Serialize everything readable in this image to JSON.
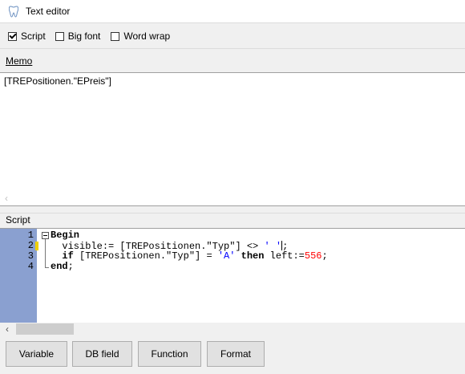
{
  "window": {
    "title": "Text editor",
    "icon": "tooth-icon"
  },
  "options": {
    "script": {
      "label": "Script",
      "checked": true
    },
    "big_font": {
      "label": "Big font",
      "checked": false
    },
    "word_wrap": {
      "label": "Word wrap",
      "checked": false
    }
  },
  "memo": {
    "label": "Memo",
    "text": "[TREPositionen.\"EPreis\"]"
  },
  "script": {
    "label": "Script",
    "line_numbers": [
      "1",
      "2",
      "3",
      "4"
    ],
    "lines": [
      {
        "indent": "",
        "parts": [
          {
            "t": "Begin",
            "c": "kw"
          }
        ]
      },
      {
        "indent": "  ",
        "parts": [
          {
            "t": "visible:= [TREPositionen.\"Typ\"] <> ",
            "c": ""
          },
          {
            "t": "' '",
            "c": "str"
          },
          {
            "t": "|",
            "c": "caret"
          },
          {
            "t": ";",
            "c": ""
          }
        ]
      },
      {
        "indent": "  ",
        "parts": [
          {
            "t": "if",
            "c": "kw"
          },
          {
            "t": " [TREPositionen.\"Typ\"] = ",
            "c": ""
          },
          {
            "t": "'A'",
            "c": "str"
          },
          {
            "t": " ",
            "c": ""
          },
          {
            "t": "then",
            "c": "kw"
          },
          {
            "t": " left:=",
            "c": ""
          },
          {
            "t": "556",
            "c": "num"
          },
          {
            "t": ";",
            "c": ""
          }
        ]
      },
      {
        "indent": "",
        "parts": [
          {
            "t": "end",
            "c": "kw"
          },
          {
            "t": ";",
            "c": ""
          }
        ]
      }
    ]
  },
  "buttons": {
    "variable": "Variable",
    "db_field": "DB field",
    "function": "Function",
    "format": "Format"
  }
}
